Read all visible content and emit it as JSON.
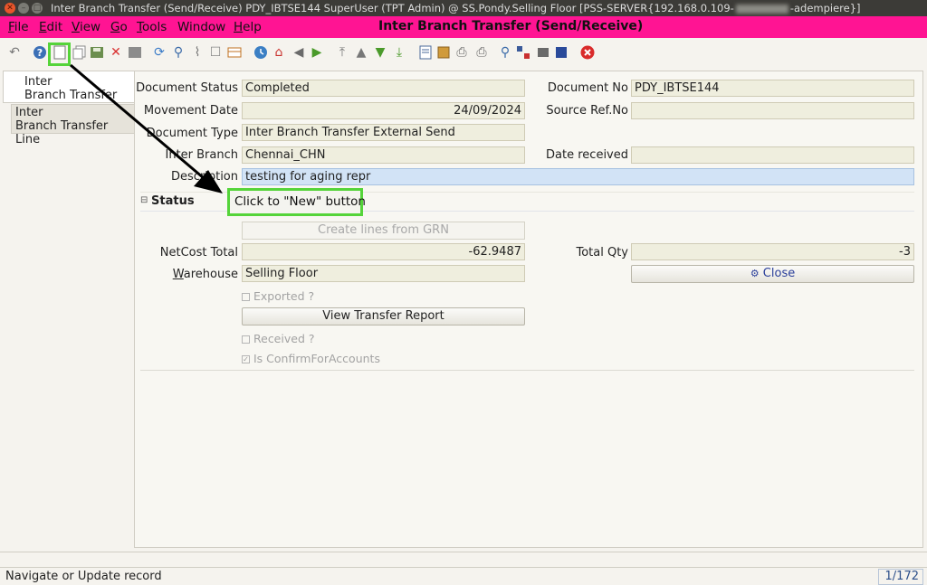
{
  "window": {
    "title_pre": "Inter Branch Transfer (Send/Receive)  PDY_IBTSE144  SuperUser (TPT Admin) @ SS.Pondy.Selling Floor [PSS-SERVER{192.168.0.109-",
    "title_post": "-adempiere}]"
  },
  "menu": {
    "items": [
      "File",
      "Edit",
      "View",
      "Go",
      "Tools",
      "Window",
      "Help"
    ],
    "accel": [
      "F",
      "E",
      "V",
      "G",
      "T",
      "",
      "H"
    ],
    "rest": [
      "ile",
      "dit",
      "iew",
      "o",
      "ools",
      "Window",
      "elp"
    ]
  },
  "app_title": "Inter Branch Transfer (Send/Receive)",
  "tabs": {
    "tab1_line1": "Inter",
    "tab1_line2": "Branch Transfer",
    "tab2_line1": "Inter",
    "tab2_line2": "Branch Transfer Line"
  },
  "form": {
    "document_status_label": "Document Status",
    "document_status": "Completed",
    "document_no_label": "Document No",
    "document_no": "PDY_IBTSE144",
    "movement_date_label": "Movement Date",
    "movement_date": "24/09/2024",
    "source_ref_label": "Source Ref.No",
    "source_ref": "",
    "document_type_label": "Document Type",
    "document_type": "Inter Branch Transfer External Send",
    "inter_branch_label": "Inter Branch",
    "inter_branch": "Chennai_CHN",
    "date_received_label": "Date received",
    "date_received": "",
    "description_label": "Description",
    "description": "testing for aging repr",
    "status_section": "Status",
    "create_lines_button": "Create lines from GRN",
    "netcost_label": "NetCost Total",
    "netcost": "-62.9487",
    "total_qty_label": "Total Qty",
    "total_qty": "-3",
    "warehouse_label": "Warehouse",
    "warehouse": "Selling Floor",
    "close_button": "Close",
    "exported_label": "Exported ?",
    "view_report_button": "View Transfer Report",
    "received_label": "Received ?",
    "confirm_label": "Is ConfirmForAccounts"
  },
  "callout": "Click to \"New\" button",
  "status": {
    "message": "Navigate or Update record",
    "record_count": "1/172"
  },
  "colors": {
    "menubar": "#ff1493",
    "highlight": "#55d43a",
    "field": "#efeede",
    "active_field": "#d2e3f6"
  }
}
